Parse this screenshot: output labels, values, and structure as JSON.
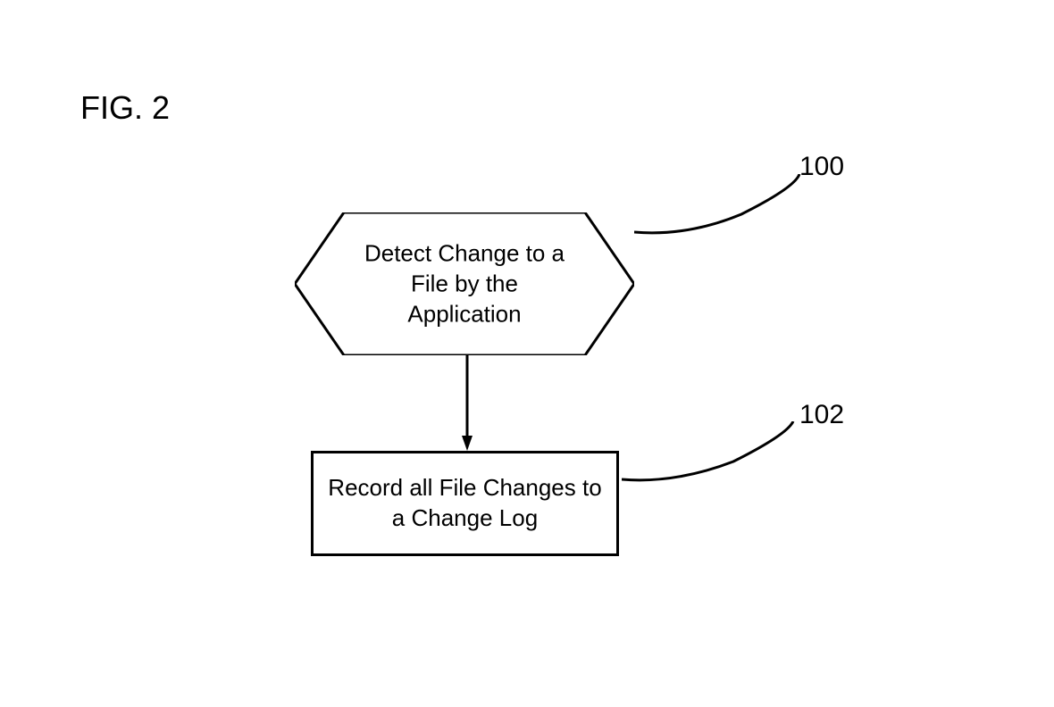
{
  "figure_label": "FIG. 2",
  "step1": {
    "text": "Detect Change to a\nFile by the\nApplication",
    "ref": "100"
  },
  "step2": {
    "text": "Record all File Changes to\na Change Log",
    "ref": "102"
  }
}
